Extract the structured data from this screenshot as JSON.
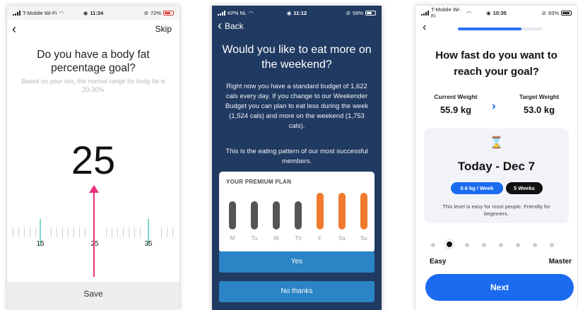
{
  "screen1": {
    "status": {
      "carrier": "T-Mobile Wi-Fi",
      "time": "11:34",
      "battery": "72%"
    },
    "skip_label": "Skip",
    "question": "Do you have a body fat percentage goal?",
    "subtitle": "Based on your sex, the normal range for body fat is 20-30%",
    "value": "25",
    "ruler_labels": [
      "15",
      "25",
      "35"
    ],
    "save_label": "Save",
    "accent_color": "#e8317a"
  },
  "screen2": {
    "status": {
      "carrier": "KPN NL",
      "time": "11:12",
      "battery": "59%"
    },
    "back_label": "Back",
    "question": "Would you like to eat more on the weekend?",
    "body": "Right now you have a standard budget of 1,622 cals every day. If you change to our Weekender Budget you can plan to eat less during the week (1,524 cals) and more on the weekend (1,753 cals).",
    "body2": "This is the eating pattern of our most successful members.",
    "plan_title": "YOUR PREMIUM PLAN",
    "days": [
      "M",
      "Tu",
      "W",
      "Th",
      "F",
      "Sa",
      "Su"
    ],
    "weekday_color": "#555555",
    "weekend_color": "#f07a2e",
    "yes_label": "Yes",
    "no_label": "No thanks",
    "background": "#213a62"
  },
  "screen3": {
    "status": {
      "carrier": "T-Mobile Wi-Fi",
      "time": "10:35",
      "battery": "83%"
    },
    "question": "How fast do you want to reach your goal?",
    "current_label": "Current Weight",
    "current_value": "55.9 kg",
    "target_label": "Target Weight",
    "target_value": "53.0 kg",
    "date": "Today - Dec 7",
    "rate_pill": "0.6 kg / Week",
    "weeks_pill": "5 Weeks",
    "note": "This level is easy for most people. Friendly for beginners.",
    "easy_label": "Easy",
    "master_label": "Master",
    "next_label": "Next",
    "progress": 0.75,
    "accent": "#1a6bf0"
  }
}
